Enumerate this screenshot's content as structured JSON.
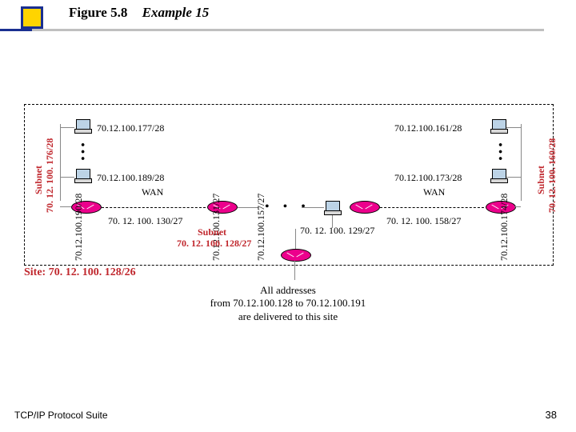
{
  "title": {
    "figure": "Figure 5.8",
    "example": "Example 15"
  },
  "footer": {
    "left": "TCP/IP Protocol Suite",
    "page": "38"
  },
  "site": "Site: 70. 12. 100. 128/26",
  "caption_l1": "All addresses",
  "caption_l2": "from 70.12.100.128 to 70.12.100.191",
  "caption_l3": "are delivered to this site",
  "subnet_center_l1": "Subnet",
  "subnet_center_l2": "70. 12. 100. 128/27",
  "left": {
    "subnet_l1": "Subnet",
    "subnet_l2": "70. 12. 100. 176/28",
    "host_top": "70.12.100.177/28",
    "host_bot": "70.12.100.189/28",
    "wan": "WAN",
    "router_s": "70. 12. 100. 130/27",
    "v_if_out": "70.12.100.190/28",
    "v_wan_far": "70.12.100.131/27"
  },
  "middle": {
    "v_left": "70.12.100.157/27",
    "router_s": "70. 12. 100. 129/27"
  },
  "right": {
    "subnet_l1": "Subnet",
    "subnet_l2": "70. 12. 100. 160/28",
    "host_top": "70.12.100.161/28",
    "host_bot": "70.12.100.173/28",
    "wan": "WAN",
    "router_s": "70. 12. 100. 158/27",
    "v_if_out": "70.12.100.174/28"
  }
}
